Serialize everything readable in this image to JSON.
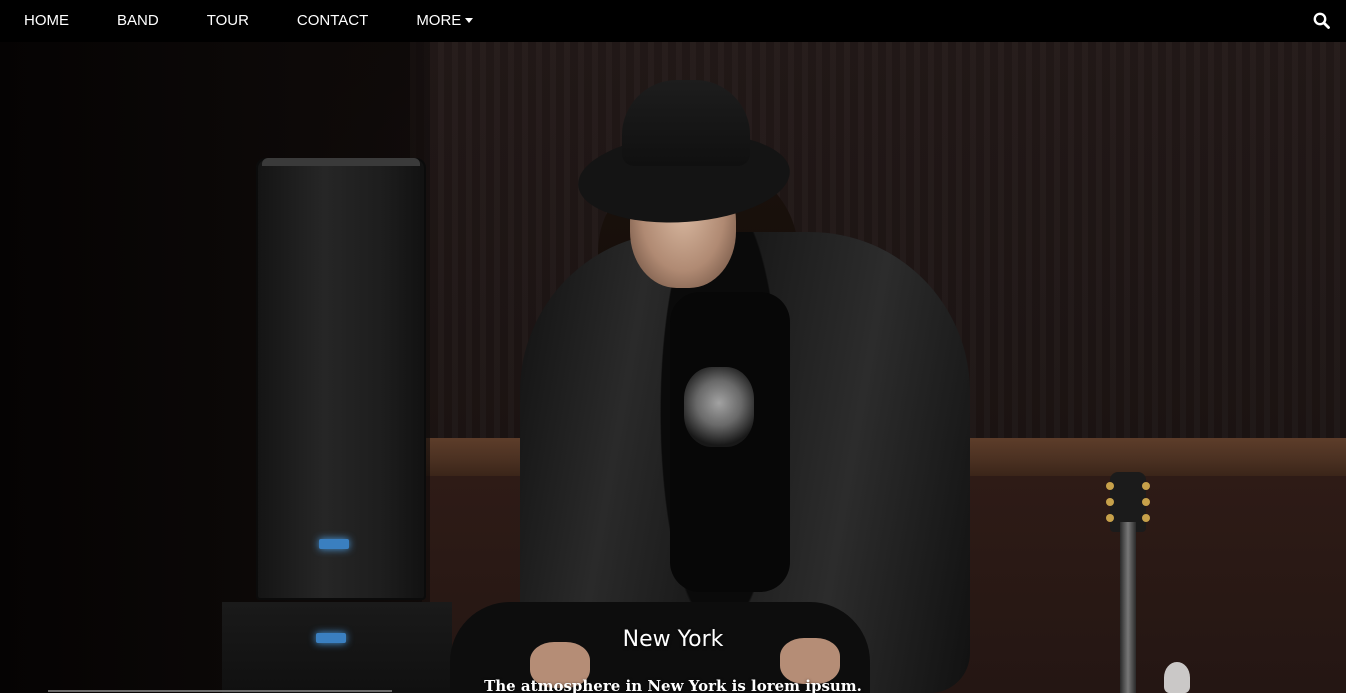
{
  "nav": {
    "items": [
      {
        "label": "HOME"
      },
      {
        "label": "BAND"
      },
      {
        "label": "TOUR"
      },
      {
        "label": "CONTACT"
      },
      {
        "label": "MORE"
      }
    ],
    "search_icon": "search-icon",
    "more_icon": "caret-down-icon"
  },
  "hero": {
    "caption_title": "New York",
    "caption_text": "The atmosphere in New York is lorem ipsum."
  },
  "colors": {
    "navbar_bg": "#000000",
    "nav_text": "#ffffff",
    "caption_text": "#ffffff"
  }
}
